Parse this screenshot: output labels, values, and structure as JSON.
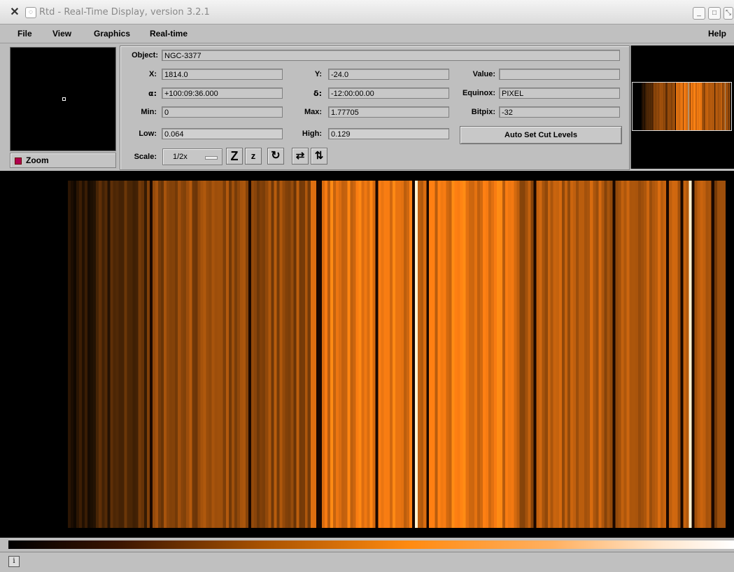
{
  "window": {
    "title": "Rtd - Real-Time Display, version 3.2.1",
    "icons": [
      "x-app-icon",
      "pin-icon",
      "minimize-icon",
      "maximize-icon",
      "close-icon"
    ]
  },
  "menu": {
    "file": "File",
    "view": "View",
    "graphics": "Graphics",
    "realtime": "Real-time",
    "help": "Help"
  },
  "zoom": {
    "label": "Zoom"
  },
  "info": {
    "object_label": "Object:",
    "object_value": "NGC-3377",
    "x_label": "X:",
    "x_value": "1814.0",
    "y_label": "Y:",
    "y_value": "-24.0",
    "value_label": "Value:",
    "value_value": "",
    "alpha_label": "α:",
    "alpha_value": "+100:09:36.000",
    "delta_label": "δ:",
    "delta_value": "-12:00:00.00",
    "equinox_label": "Equinox:",
    "equinox_value": "PIXEL",
    "min_label": "Min:",
    "min_value": "0",
    "max_label": "Max:",
    "max_value": "1.77705",
    "bitpix_label": "Bitpix:",
    "bitpix_value": "-32",
    "low_label": "Low:",
    "low_value": "0.064",
    "high_label": "High:",
    "high_value": "0.129",
    "autoset_label": "Auto Set Cut Levels",
    "scale_label": "Scale:",
    "scale_value": "1/2x"
  },
  "toolbar": {
    "icons": [
      "zoom-in-icon",
      "zoom-out-icon",
      "rotate-icon",
      "flip-x-icon",
      "flip-y-icon"
    ],
    "zoom_in_glyph": "Z",
    "zoom_out_glyph": "z",
    "rotate_glyph": "↻",
    "flipx_glyph": "⇄",
    "flipy_glyph": "⇅"
  },
  "status": {
    "icon_glyph": "i"
  },
  "colors": {
    "spectrum_dark": "#3a1400",
    "spectrum_mid": "#a85200",
    "spectrum_bright": "#ff8a10",
    "spectrum_white": "#ffffff"
  }
}
